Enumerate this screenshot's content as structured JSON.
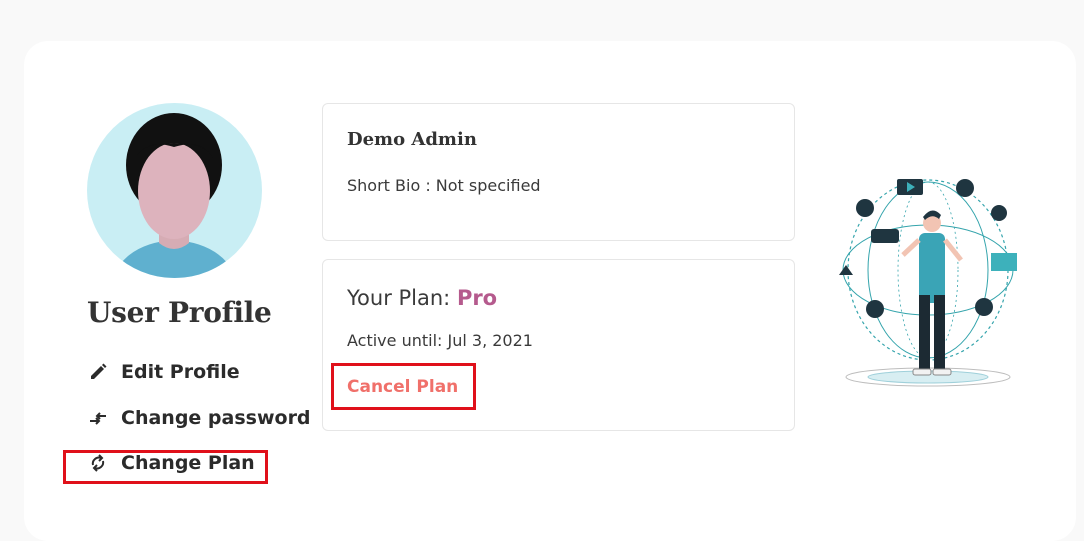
{
  "profile": {
    "title": "User Profile",
    "menu": [
      {
        "label": "Edit Profile",
        "icon": "pencil-icon"
      },
      {
        "label": "Change password",
        "icon": "swap-arrows-icon"
      },
      {
        "label": "Change Plan",
        "icon": "refresh-icon"
      }
    ]
  },
  "info": {
    "name": "Demo Admin",
    "bio": "Short Bio : Not specified"
  },
  "plan": {
    "label": "Your Plan: ",
    "name": "Pro",
    "active_until": "Active until: Jul 3, 2021",
    "cancel_label": "Cancel Plan"
  },
  "colors": {
    "accent_plan": "#b55a8d",
    "cancel": "#f0706a",
    "highlight_box": "#e0101a",
    "avatar_bg": "#c9eef4"
  }
}
